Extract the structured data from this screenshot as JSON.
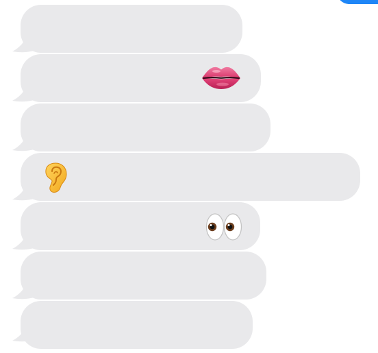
{
  "colors": {
    "incoming_bubble": "#e9e9eb",
    "outgoing_bubble": "#1e86f7"
  },
  "messages": [
    {
      "sender": "incoming",
      "text": "",
      "emoji": null
    },
    {
      "sender": "incoming",
      "text": "",
      "emoji": "lips-emoji"
    },
    {
      "sender": "incoming",
      "text": "",
      "emoji": null
    },
    {
      "sender": "incoming",
      "text": "",
      "emoji": "ear-emoji"
    },
    {
      "sender": "incoming",
      "text": "",
      "emoji": "eyes-emoji"
    },
    {
      "sender": "incoming",
      "text": "",
      "emoji": null
    },
    {
      "sender": "incoming",
      "text": "",
      "emoji": null
    }
  ]
}
